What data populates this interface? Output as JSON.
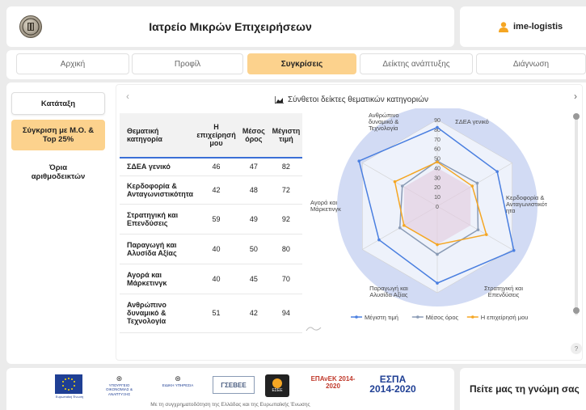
{
  "header": {
    "title": "Ιατρείο Μικρών Επιχειρήσεων",
    "user": "ime-logistis"
  },
  "tabs": [
    {
      "label": "Αρχική",
      "active": false
    },
    {
      "label": "Προφίλ",
      "active": false
    },
    {
      "label": "Συγκρίσεις",
      "active": true
    },
    {
      "label": "Δείκτης ανάπτυξης",
      "active": false
    },
    {
      "label": "Διάγνωση",
      "active": false
    }
  ],
  "sidebar": {
    "items": [
      {
        "label": "Κατάταξη"
      },
      {
        "label": "Σύγκριση με Μ.Ο. & Top 25%"
      },
      {
        "label": "Όρια αριθμοδεικτών"
      }
    ]
  },
  "panel": {
    "heading": "Σύνθετοι δείκτες θεματικών κατηγοριών",
    "prev_icon": "chevron-left-icon",
    "next_icon": "chevron-right-icon",
    "help": "?"
  },
  "table": {
    "headers": [
      "Θεματική κατηγορία",
      "Η επιχείρησή μου",
      "Μέσος όρος",
      "Μέγιστη τιμή"
    ],
    "rows": [
      [
        "ΣΔΕΑ γενικό",
        "46",
        "47",
        "82"
      ],
      [
        "Κερδοφορία & Ανταγωνιστικότητα",
        "42",
        "48",
        "72"
      ],
      [
        "Στρατηγική και Επενδύσεις",
        "59",
        "49",
        "92"
      ],
      [
        "Παραγωγή και Αλυσίδα Αξίας",
        "40",
        "50",
        "80"
      ],
      [
        "Αγορά και Μάρκετινγκ",
        "40",
        "45",
        "70"
      ],
      [
        "Ανθρώπινο δυναμικό & Τεχνολογία",
        "51",
        "42",
        "94"
      ]
    ]
  },
  "chart_data": {
    "type": "radar",
    "axes": [
      "ΣΔΕΑ γενικό",
      "Κερδοφορία & Ανταγωνιστικότητα",
      "Στρατηγική και Επενδύσεις",
      "Παραγωγή και Αλυσίδα Αξίας",
      "Αγορά και Μάρκετινγκ",
      "Ανθρώπινο δυναμικό & Τεχνολογία"
    ],
    "axis_labels": [
      "ΣΔΕΑ γενικό",
      "Κερδοφορία & Ανταγωνιστικότ ητα",
      "Στρατηγική και Επενδύσεις",
      "Παραγωγή και Αλυσίδα Αξίας",
      "Αγορά και Μάρκετινγκ",
      "Ανθρώπινο δυναμικό & Τεχνολογία"
    ],
    "rmin": 0,
    "rmax": 90,
    "ticks": [
      0,
      10,
      20,
      30,
      40,
      50,
      60,
      70,
      80,
      90
    ],
    "series": [
      {
        "name": "Μέγιστη τιμή",
        "color": "#4a7fe0",
        "values": [
          82,
          72,
          92,
          80,
          70,
          94
        ]
      },
      {
        "name": "Μέσος όρος",
        "color": "#8a9bb5",
        "values": [
          47,
          48,
          49,
          50,
          45,
          42
        ]
      },
      {
        "name": "Η επιχείρησή μου",
        "color": "#f5a623",
        "values": [
          46,
          42,
          59,
          40,
          40,
          51
        ]
      }
    ],
    "legend_position": "bottom"
  },
  "footer": {
    "caption": "Με τη συγχρηματοδότηση της Ελλάδας και της Ευρωπαϊκής Ένωσης",
    "opinion": "Πείτε μας τη γνώμη σας",
    "logos": [
      {
        "name": "eu-flag-logo",
        "text": "Ευρωπαϊκή Ένωση"
      },
      {
        "name": "ministry-logo",
        "text": "ΥΠΟΥΡΓΕΙΟ ΟΙΚΟΝΟΜΙΑΣ & ΑΝΑΠΤΥΞΗΣ"
      },
      {
        "name": "ministry2-logo",
        "text": "ΕΙΔΙΚΗ ΥΠΗΡΕΣΙΑ"
      },
      {
        "name": "esee-logo",
        "text": "ΓΣΕΒΕΕ"
      },
      {
        "name": "eoe-logo",
        "text": "ΕΣΕΕ"
      },
      {
        "name": "epanek-logo",
        "text": "ΕΠΑνΕΚ 2014-2020"
      },
      {
        "name": "espa-logo",
        "text": "ΕΣΠΑ 2014-2020"
      }
    ]
  },
  "colors": {
    "accent": "#fcd28d",
    "table_underline": "#3b6fd6"
  }
}
